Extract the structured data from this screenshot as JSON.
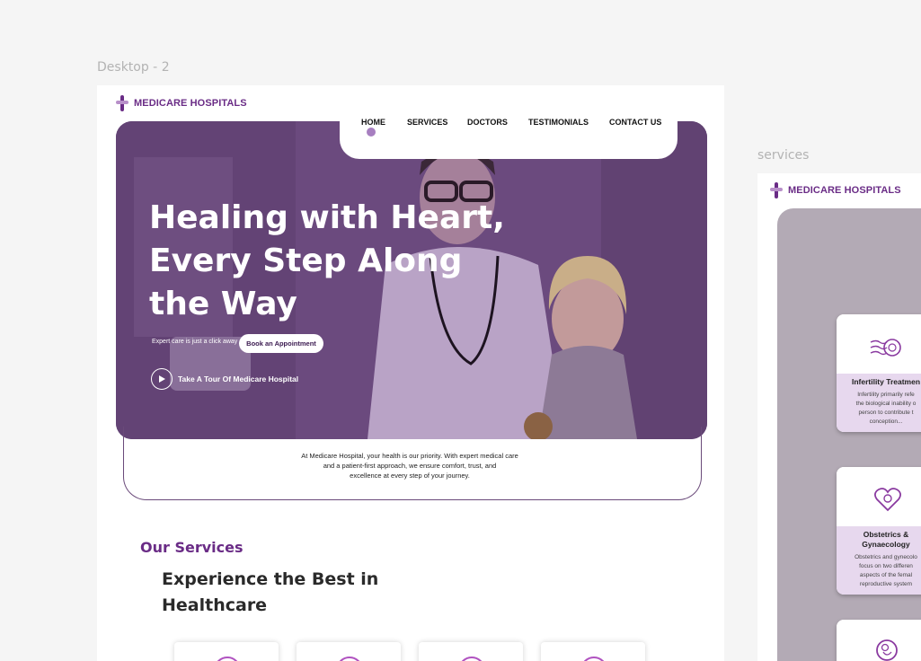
{
  "frames": {
    "desktop_label": "Desktop - 2",
    "services_label": "services"
  },
  "brand": {
    "name": "MEDICARE HOSPITALS"
  },
  "nav": {
    "items": [
      "HOME",
      "SERVICES",
      "DOCTORS",
      "TESTIMONIALS",
      "CONTACT US"
    ],
    "active": "HOME"
  },
  "hero": {
    "title_lines": [
      "Healing with Heart,",
      "Every Step Along",
      "the Way"
    ],
    "tagline": "Expert care is just a click away",
    "cta": "Book an Appointment",
    "tour": "Take A Tour Of Medicare Hospital"
  },
  "about": {
    "lines": [
      "At Medicare Hospital, your health is our priority. With expert medical care",
      "and a patient-first approach, we ensure comfort, trust, and",
      "excellence at every step of your journey."
    ]
  },
  "services_section": {
    "eyebrow": "Our Services",
    "title_lines": [
      "Experience the Best in",
      "Healthcare"
    ]
  },
  "services_cards": [
    {
      "title": "Infertility Treatmen",
      "desc_lines": [
        "Infertility primarily refe",
        "the biological inability o",
        "person to contribute t",
        "conception..."
      ],
      "icon": "sperm-icon"
    },
    {
      "title_lines": [
        "Obstetrics &",
        "Gynaecology"
      ],
      "desc_lines": [
        "Obstetrics and gynecolo",
        "focus on two differen",
        "aspects of the femal",
        "reproductive system"
      ],
      "icon": "heart-baby-icon"
    },
    {
      "icon": "fetus-icon"
    }
  ],
  "colors": {
    "brand": "#6a2c86",
    "accent": "#a77fc0",
    "hero_overlay": "#6d4a80"
  }
}
